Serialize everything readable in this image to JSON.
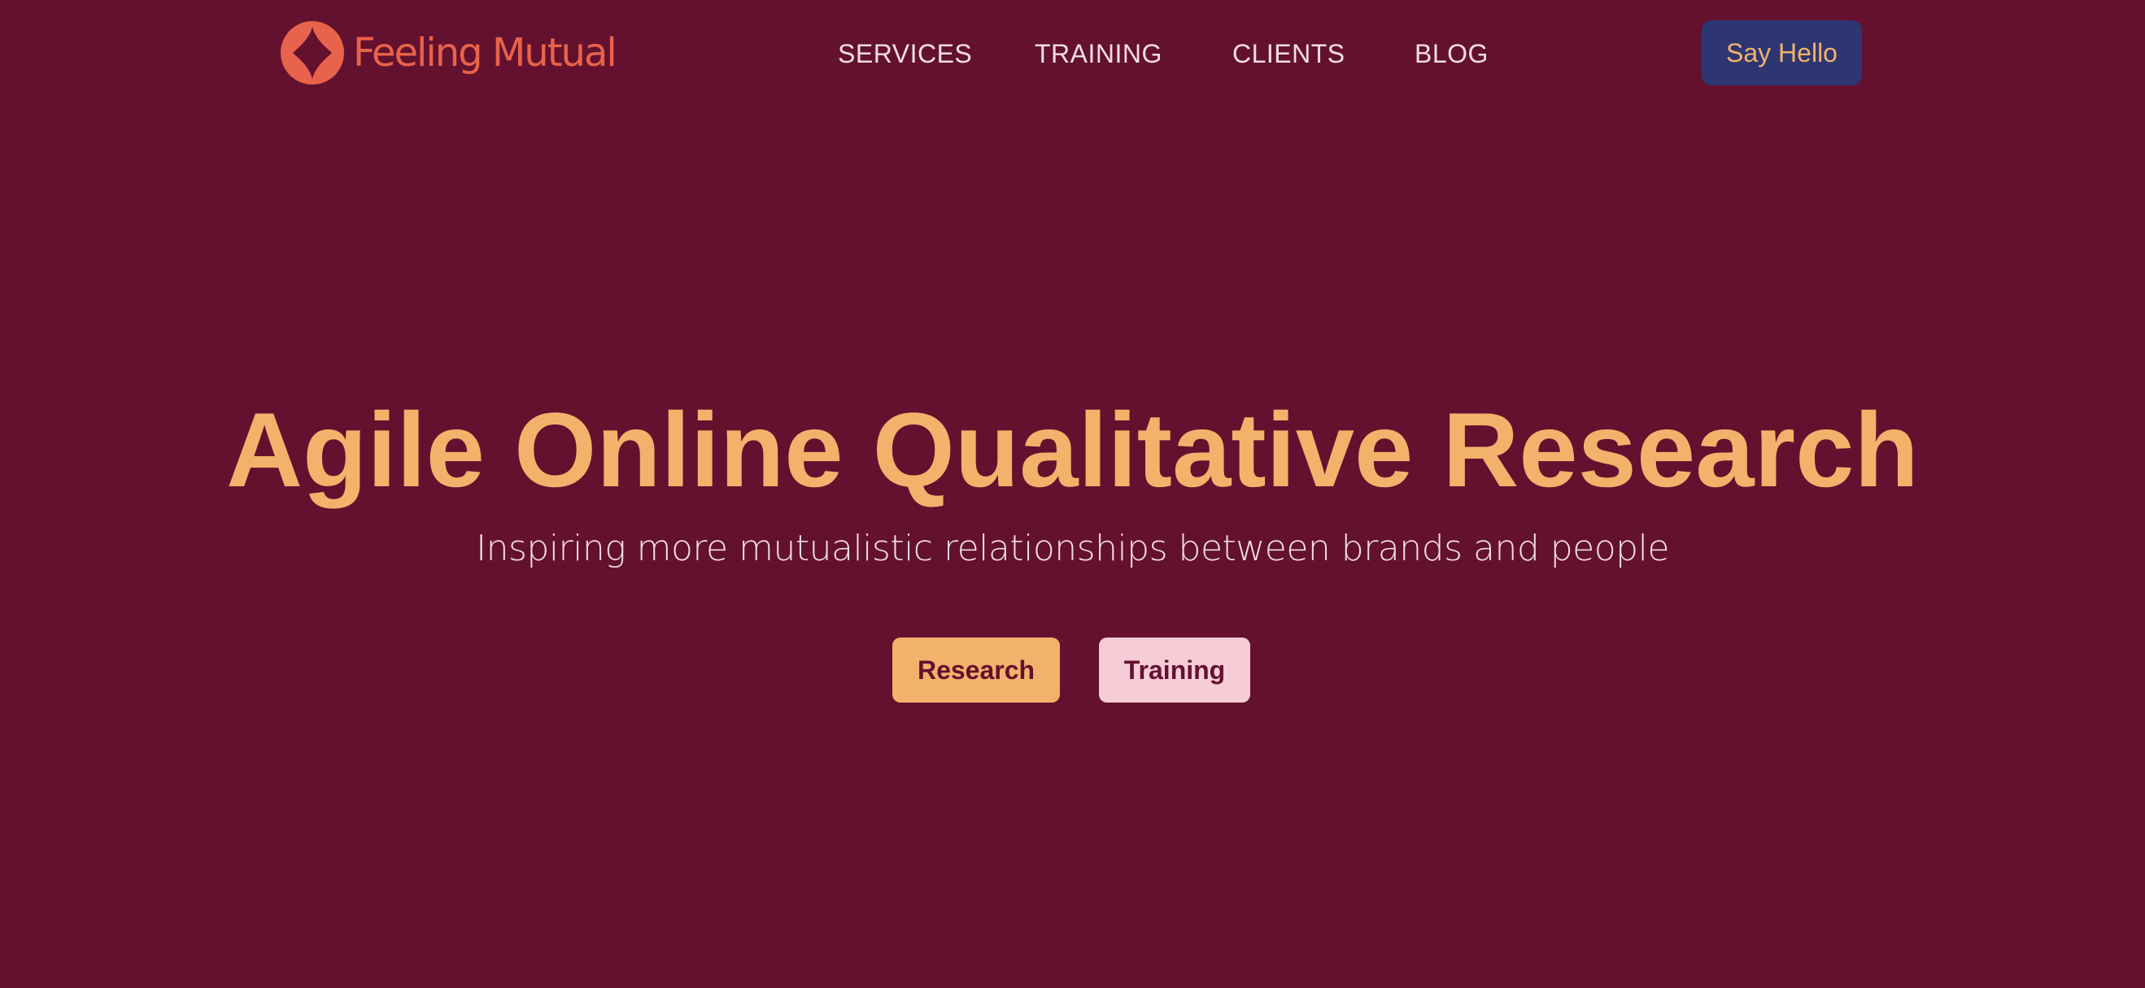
{
  "brand": {
    "name": "Feeling Mutual",
    "logo_icon": "feeling-mutual-logo-icon"
  },
  "nav": {
    "items": [
      {
        "label": "SERVICES"
      },
      {
        "label": "TRAINING"
      },
      {
        "label": "CLIENTS"
      },
      {
        "label": "BLOG"
      }
    ],
    "cta_label": "Say Hello"
  },
  "hero": {
    "title": "Agile Online Qualitative Research",
    "subtitle": "Inspiring more mutualistic relationships between brands and people",
    "buttons": [
      {
        "label": "Research"
      },
      {
        "label": "Training"
      }
    ]
  },
  "colors": {
    "background": "#63112e",
    "logo": "#e8634c",
    "accent_orange": "#f2b26b",
    "accent_pink": "#f6ccd7",
    "nav_text": "#f3dde4",
    "cta_navy": "#2d3671"
  }
}
